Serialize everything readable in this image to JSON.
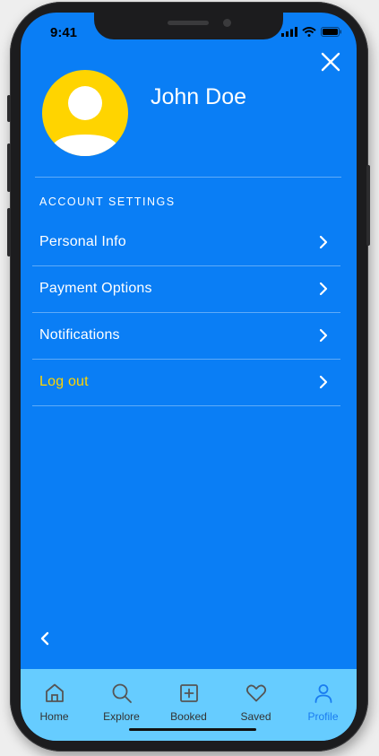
{
  "status_bar": {
    "time": "9:41"
  },
  "profile": {
    "name": "John Doe"
  },
  "account_settings": {
    "title": "ACCOUNT SETTINGS",
    "items": [
      {
        "label": "Personal Info"
      },
      {
        "label": "Payment Options"
      },
      {
        "label": "Notifications"
      },
      {
        "label": "Log out"
      }
    ]
  },
  "tab_bar": {
    "tabs": [
      {
        "label": "Home",
        "icon": "home-icon"
      },
      {
        "label": "Explore",
        "icon": "search-icon"
      },
      {
        "label": "Booked",
        "icon": "plus-square-icon"
      },
      {
        "label": "Saved",
        "icon": "heart-icon"
      },
      {
        "label": "Profile",
        "icon": "user-icon"
      }
    ],
    "active": "Profile"
  },
  "colors": {
    "background": "#0a7ef5",
    "avatar": "#ffd400",
    "logout": "#ffd400",
    "tab_bar": "#66ccff",
    "active_tab": "#1a7cf0"
  }
}
